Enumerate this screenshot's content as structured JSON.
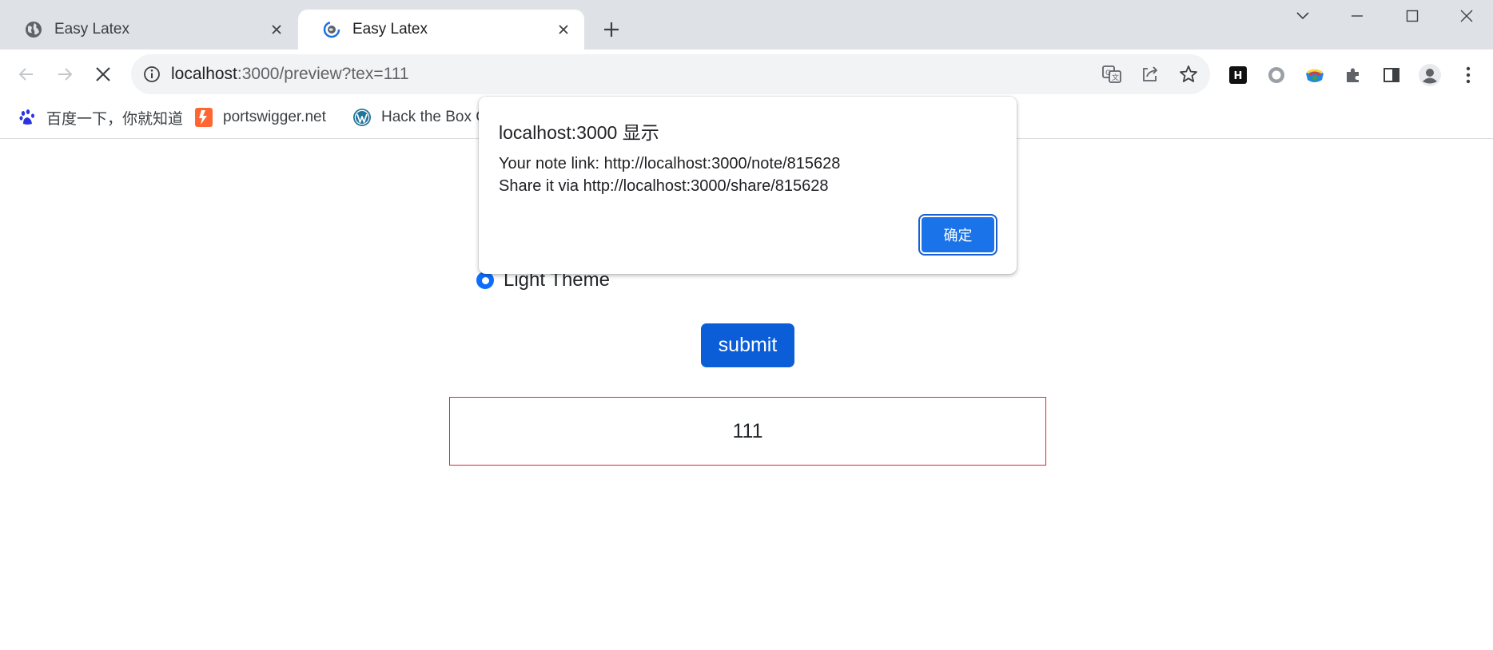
{
  "tabs": [
    {
      "title": "Easy Latex",
      "active": false
    },
    {
      "title": "Easy Latex",
      "active": true
    }
  ],
  "toolbar": {
    "url_host": "localhost",
    "url_rest": ":3000/preview?tex=111"
  },
  "bookmarks": [
    {
      "label": "百度一下，你就知道",
      "icon": "baidu-paw-icon"
    },
    {
      "label": "portswigger.net",
      "icon": "portswigger-bolt-icon"
    },
    {
      "label": "Hack the Box C",
      "icon": "wordpress-icon"
    }
  ],
  "page": {
    "radio_label": "Light Theme",
    "radio_checked": true,
    "submit_label": "submit",
    "preview_text": "111"
  },
  "dialog": {
    "title": "localhost:3000 显示",
    "line1": "Your note link: http://localhost:3000/note/815628",
    "line2": "Share it via http://localhost:3000/share/815628",
    "ok_label": "确定"
  },
  "colors": {
    "tabstrip": "#dee1e6",
    "accent": "#1a73e8",
    "submit": "#0b5ed7",
    "preview_border": "#e0262d"
  }
}
